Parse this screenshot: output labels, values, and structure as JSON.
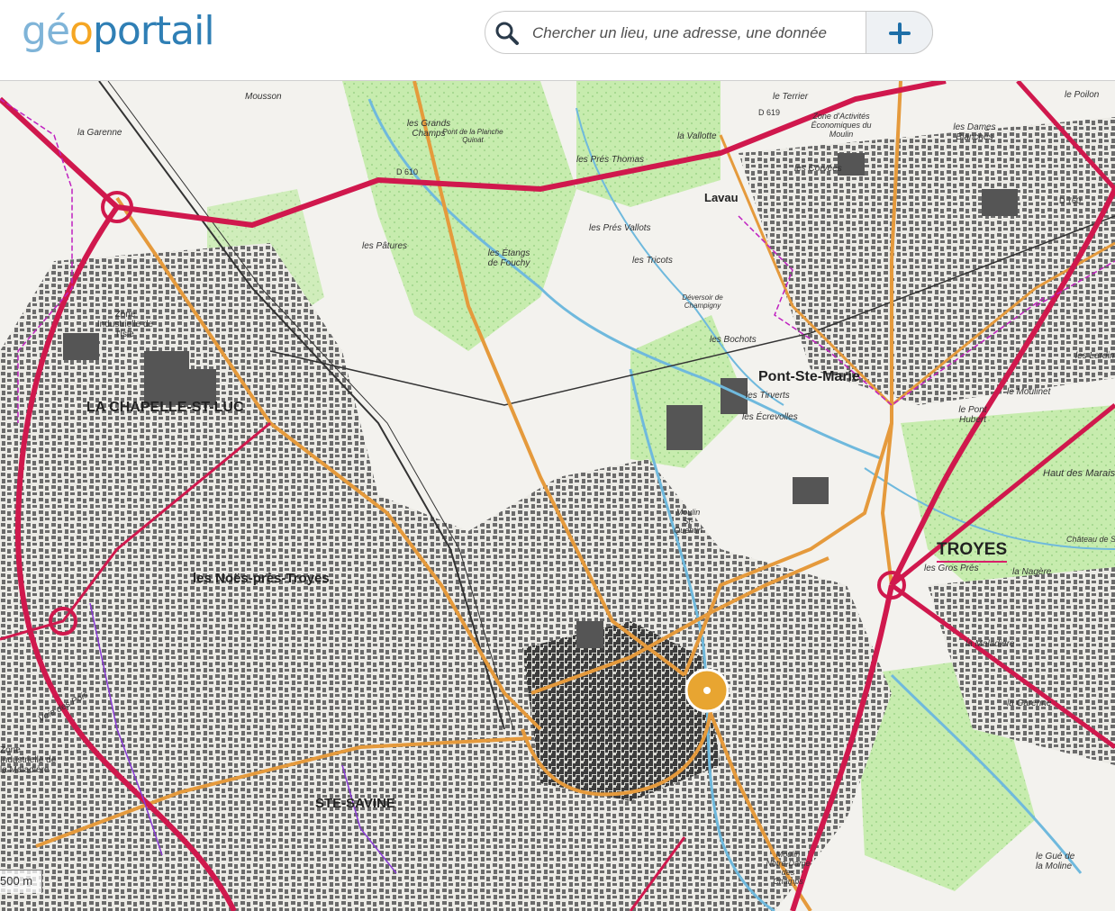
{
  "header": {
    "logo": {
      "g": "g",
      "e": "é",
      "o": "o",
      "rest": "portail"
    },
    "search": {
      "placeholder": "Chercher un lieu, une adresse, une donnée"
    },
    "add_button_icon": "plus-icon"
  },
  "map": {
    "places": {
      "troyes": "TROYES",
      "pont_ste_marie": "Pont-Ste-Marie",
      "la_chapelle": "LA CHAPELLE-ST-LUC",
      "les_noes": "les Noës-près-Troyes",
      "ste_savine": "STE-SAVINE",
      "lavau": "Lavau",
      "zone_isle": "Zone Industrielle de l'Isle",
      "zone_maladiere": "Zone Industrielle de la Maladière",
      "les_grands_champs": "les Grands Champs",
      "les_pres_thomas": "les Prés Thomas",
      "les_pres_vallots": "les Prés Vallots",
      "les_tricots": "les Tricots",
      "les_paturas": "les Pâtures",
      "les_etangs": "les Étangs de Fouchy",
      "la_vallotte": "la Vallotte",
      "les_dames_blanches": "les Dames Blanches",
      "les_corvees": "les Corvées",
      "zone_activites": "Zone d'Activités Économiques du Moulin",
      "hauts_marais": "Haut des Marais",
      "les_gros_pres": "les Gros Prés",
      "la_nagere": "la Nagère",
      "chateau": "Château de St-P.",
      "les_bochots": "les Bochots",
      "les_tirverts": "les Tirverts",
      "les_ecrevolles": "les Écrevolles",
      "le_pont_hubert": "le Pont Hubert",
      "le_moulinet": "le Moulinet",
      "les_lardins": "les Lardins",
      "la_maladiere": "la Maladière",
      "la_garenne": "la Garenne",
      "le_poilon": "le Poilon",
      "le_terrier": "le Terrier",
      "mousson": "Mousson",
      "la_garenne_nw": "la Garenne",
      "voie_des_pois": "Voie des Pois",
      "le_gue": "le Gué de la Moline",
      "deversoir": "Déversoir de Champigny",
      "moulin_st_quentin": "Moulin St-Quentin",
      "notre_dame": "Moulin Notre-Dame des Champs",
      "pont_planche": "Pont de la Planche Quinat",
      "d610": "D 610",
      "d619": "D 619",
      "d760": "D 760"
    },
    "scale": "500 m",
    "colors": {
      "motorway": "#d0184d",
      "main_road": "#e59a3c",
      "water": "#7bc2e0",
      "forest": "#bfe8a4",
      "buildings": "#5f5f5f",
      "boundary": "#c020c0"
    },
    "marker_icon": "location-pin-icon"
  }
}
